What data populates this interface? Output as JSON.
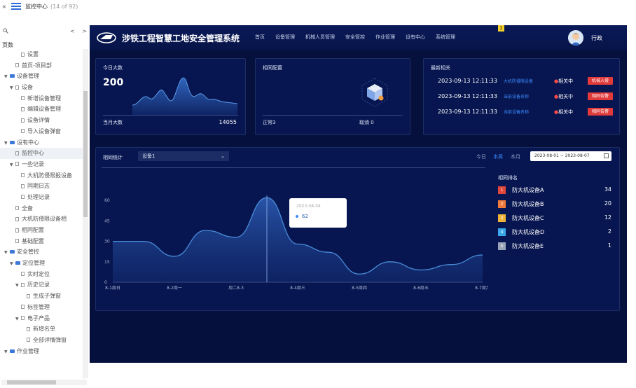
{
  "topbar": {
    "close": "×",
    "title": "监控中心",
    "count": "(14 of 92)"
  },
  "sidebar": {
    "search_icon": "search-icon",
    "nav_prev": "<",
    "nav_next": ">",
    "title": "页数",
    "items": [
      {
        "label": "设置",
        "level": 2,
        "type": "doc",
        "expand": ""
      },
      {
        "label": "首页-项目部",
        "level": 1,
        "type": "doc",
        "expand": ""
      },
      {
        "label": "设备管理",
        "level": 0,
        "type": "folder",
        "expand": "▼"
      },
      {
        "label": "设备",
        "level": 1,
        "type": "doc",
        "expand": "▼"
      },
      {
        "label": "新增设备管理",
        "level": 2,
        "type": "doc",
        "expand": ""
      },
      {
        "label": "编辑设备管理",
        "level": 2,
        "type": "doc",
        "expand": ""
      },
      {
        "label": "设备详情",
        "level": 2,
        "type": "doc",
        "expand": ""
      },
      {
        "label": "导入设备弹窗",
        "level": 2,
        "type": "doc",
        "expand": ""
      },
      {
        "label": "设有中心",
        "level": 0,
        "type": "folder",
        "expand": "▼"
      },
      {
        "label": "监控中心",
        "level": 1,
        "type": "doc",
        "expand": "",
        "selected": true
      },
      {
        "label": "一些记录",
        "level": 1,
        "type": "doc",
        "expand": "▼"
      },
      {
        "label": "大机防侵限报设备",
        "level": 2,
        "type": "doc",
        "expand": ""
      },
      {
        "label": "同期日志",
        "level": 2,
        "type": "doc",
        "expand": ""
      },
      {
        "label": "处理记录",
        "level": 2,
        "type": "doc",
        "expand": ""
      },
      {
        "label": "全备",
        "level": 1,
        "type": "doc",
        "expand": ""
      },
      {
        "label": "大机防侵限设备相",
        "level": 1,
        "type": "doc",
        "expand": ""
      },
      {
        "label": "相同配置",
        "level": 1,
        "type": "doc",
        "expand": ""
      },
      {
        "label": "基础配置",
        "level": 1,
        "type": "doc",
        "expand": ""
      },
      {
        "label": "安全管控",
        "level": 0,
        "type": "folder",
        "expand": "▼"
      },
      {
        "label": "定位管理",
        "level": 1,
        "type": "folder",
        "expand": "▼"
      },
      {
        "label": "实时定位",
        "level": 2,
        "type": "doc",
        "expand": ""
      },
      {
        "label": "历史记录",
        "level": 2,
        "type": "doc",
        "expand": "▼"
      },
      {
        "label": "生成子弹窗",
        "level": 3,
        "type": "doc",
        "expand": ""
      },
      {
        "label": "标签管理",
        "level": 2,
        "type": "doc",
        "expand": ""
      },
      {
        "label": "电子产品",
        "level": 2,
        "type": "doc",
        "expand": "▼"
      },
      {
        "label": "新增名单",
        "level": 3,
        "type": "doc",
        "expand": ""
      },
      {
        "label": "全部详情弹窗",
        "level": 3,
        "type": "doc",
        "expand": ""
      },
      {
        "label": "作业管理",
        "level": 0,
        "type": "folder",
        "expand": "▼"
      }
    ]
  },
  "header": {
    "app_title": "涉铁工程智慧工地安全管理系统",
    "nav": [
      "首页",
      "设备管理",
      "机械人员管理",
      "安全管控",
      "作业管理",
      "设有中心",
      "系统管理"
    ],
    "badge": "1",
    "user": "行政"
  },
  "today_card": {
    "title": "今日大数",
    "value": "200",
    "foot_label": "当月大数",
    "foot_value": "14055"
  },
  "config_card": {
    "title": "相同配置",
    "normal": "正常3",
    "cancel": "取消 0"
  },
  "records_card": {
    "title": "最新相关",
    "rows": [
      {
        "time": "2023-09-13 12:11:33",
        "link": "大机防侵限设备",
        "status_mark": "●",
        "status": "相关中",
        "tag": "机械入侵"
      },
      {
        "time": "2023-09-13 12:11:33",
        "link": "当前设备名称",
        "status_mark": "●",
        "status": "相关中",
        "tag": "相同告警"
      },
      {
        "time": "2023-09-13 12:11:33",
        "link": "当前设备名称",
        "status_mark": "●",
        "status": "相关中",
        "tag": "相同告警"
      }
    ]
  },
  "stats": {
    "label": "相同统计",
    "device_select": "设备1",
    "ranges": [
      "今日",
      "本周",
      "本月"
    ],
    "active_range": "本周",
    "date_range": "2023-08-01 ~ 2023-08-07",
    "rank_title": "相同排名",
    "ranks": [
      {
        "n": "1",
        "name": "防大机设备A",
        "value": "34",
        "color": "#e0463a"
      },
      {
        "n": "2",
        "name": "防大机设备B",
        "value": "20",
        "color": "#f07b3a"
      },
      {
        "n": "3",
        "name": "防大机设备C",
        "value": "12",
        "color": "#f0b43a"
      },
      {
        "n": "4",
        "name": "防大机设备D",
        "value": "2",
        "color": "#3aa8e8"
      },
      {
        "n": "5",
        "name": "防大机设备E",
        "value": "1",
        "color": "#9aa4b8"
      }
    ],
    "tooltip_date": "2023-08-04",
    "tooltip_value": "62"
  },
  "chart_data": {
    "type": "area",
    "x": [
      "8-1周日",
      "8-2周一",
      "周二8-3",
      "8-4周三",
      "8-5周四",
      "8-6周五",
      "8-7周六"
    ],
    "yticks": [
      0,
      15,
      30,
      45,
      60
    ],
    "ylim": [
      0,
      75
    ],
    "series": [
      {
        "values": [
          30,
          30,
          19,
          38,
          33,
          62,
          28,
          22,
          6,
          15,
          9,
          13,
          20
        ]
      }
    ],
    "x_positions_note": "",
    "grid": false,
    "color": "#4a8bd8"
  },
  "colors": {
    "bg": "#05103c",
    "card": "#071650",
    "accent": "#3d8bff",
    "danger": "#e03a3a"
  }
}
